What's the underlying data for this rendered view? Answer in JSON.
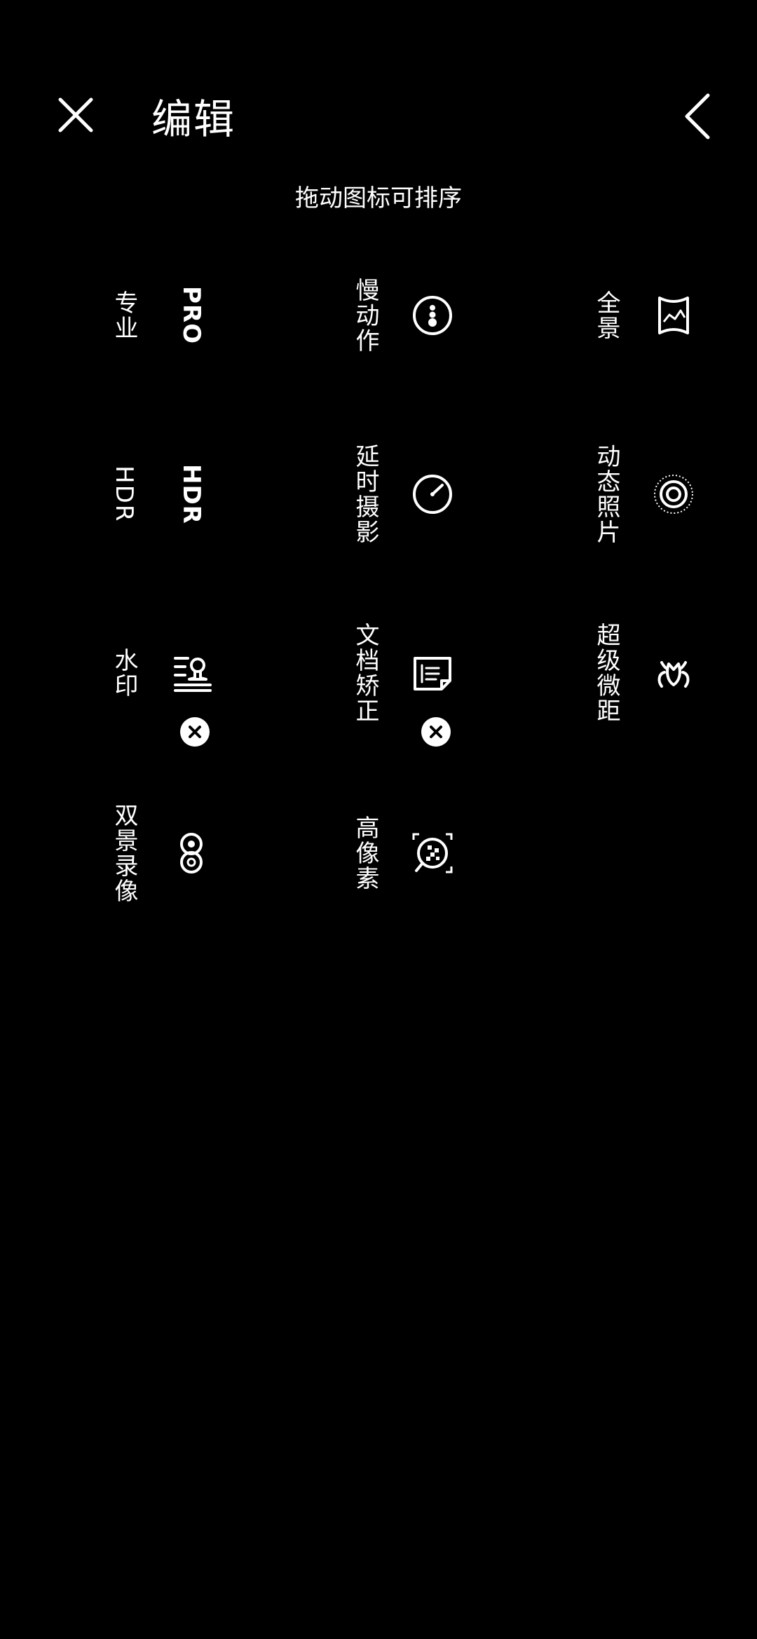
{
  "header": {
    "title": "编辑",
    "close_icon": "close-icon",
    "back_icon": "chevron-left-icon"
  },
  "hint": "拖动图标可排序",
  "modes": [
    {
      "label": "专业",
      "icon": "pro-text-icon",
      "icon_text": "PRO"
    },
    {
      "label": "慢动作",
      "icon": "slow-motion-icon"
    },
    {
      "label": "全景",
      "icon": "panorama-icon"
    },
    {
      "label": "HDR",
      "icon": "hdr-text-icon",
      "icon_text": "HDR"
    },
    {
      "label": "延时摄影",
      "icon": "time-lapse-icon"
    },
    {
      "label": "动态照片",
      "icon": "live-photo-icon"
    },
    {
      "label": "水印",
      "icon": "watermark-stamp-icon",
      "removable": true
    },
    {
      "label": "文档矫正",
      "icon": "document-correction-icon",
      "removable": true
    },
    {
      "label": "超级微距",
      "icon": "super-macro-icon"
    },
    {
      "label": "双景录像",
      "icon": "dual-view-video-icon"
    },
    {
      "label": "高像素",
      "icon": "high-pixel-icon"
    }
  ]
}
